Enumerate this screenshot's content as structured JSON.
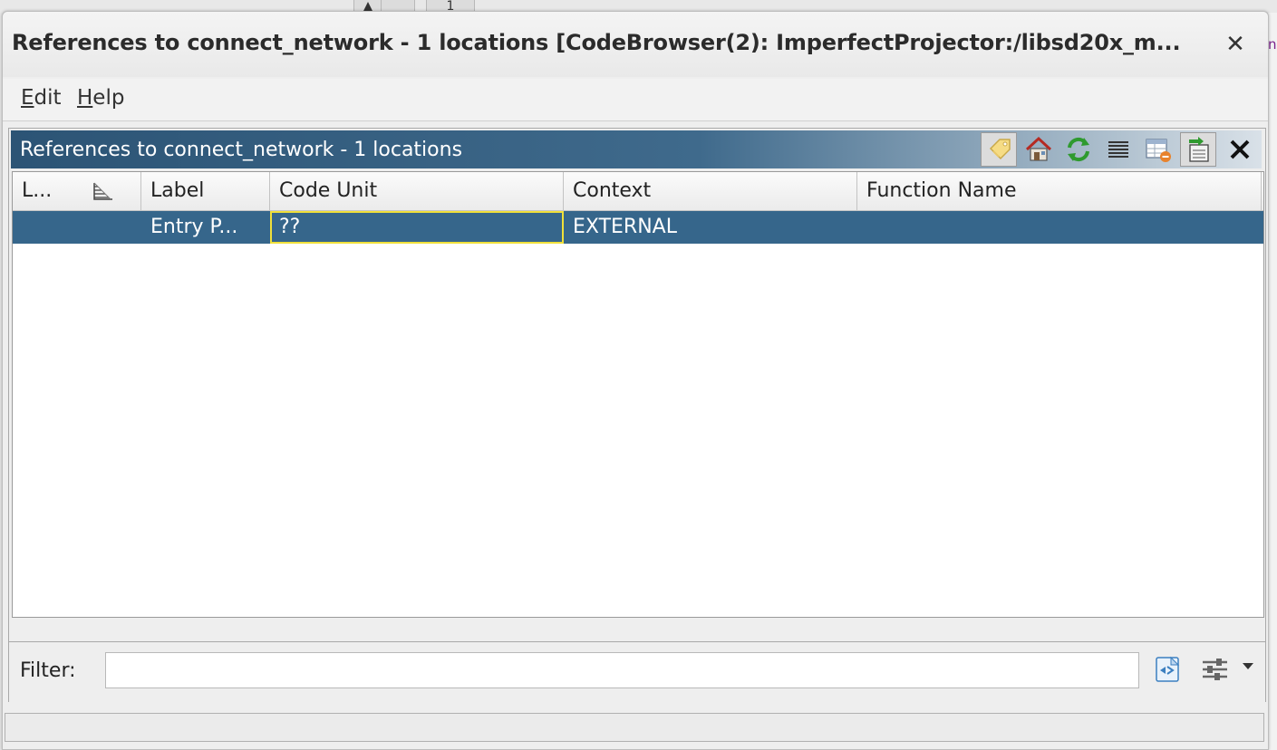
{
  "background": {
    "tab_label": "1",
    "right_edge_char": "n"
  },
  "window": {
    "title": "References to connect_network - 1 locations [CodeBrowser(2): ImperfectProjector:/libsd20x_m...",
    "close_glyph": "✕"
  },
  "menu": {
    "items": [
      {
        "mnemonic": "E",
        "rest": "dit"
      },
      {
        "mnemonic": "H",
        "rest": "elp"
      }
    ]
  },
  "panel": {
    "title": "References to connect_network - 1 locations",
    "toolbar": [
      {
        "icon": "label-tag-icon",
        "pressed": true
      },
      {
        "icon": "home-icon",
        "pressed": false
      },
      {
        "icon": "refresh-icon",
        "pressed": false
      },
      {
        "icon": "lines-icon",
        "pressed": false
      },
      {
        "icon": "table-delete-icon",
        "pressed": false
      },
      {
        "icon": "snapshot-icon",
        "pressed": true
      },
      {
        "icon": "close-panel-icon",
        "pressed": false
      }
    ],
    "close_glyph": "✕"
  },
  "table": {
    "columns": [
      "L...",
      "Label",
      "Code Unit",
      "Context",
      "Function Name"
    ],
    "rows": [
      {
        "location": "",
        "label": "Entry P...",
        "code_unit": "??",
        "context": "EXTERNAL",
        "function_name": ""
      }
    ]
  },
  "filter": {
    "label": "Filter:",
    "value": "",
    "placeholder": ""
  },
  "status": {
    "text": ""
  },
  "colors": {
    "selection": "#36668b",
    "header_dark": "#2c5475",
    "focus_border": "#f0e03a"
  }
}
